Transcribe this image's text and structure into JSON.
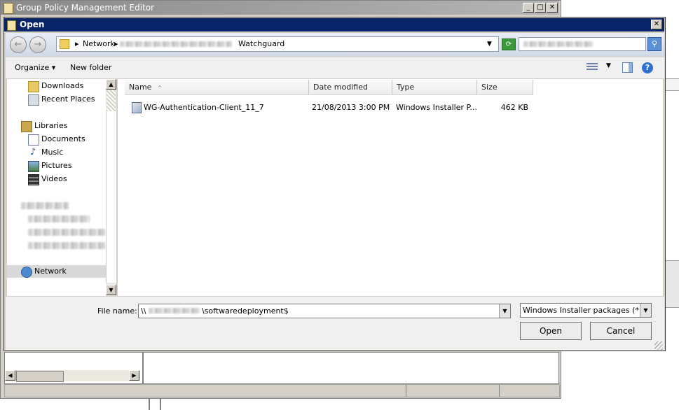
{
  "background_window": {
    "title": "Group Policy Management Editor",
    "controls": {
      "minimize": "_",
      "maximize": "□",
      "close": "✕"
    }
  },
  "dialog": {
    "title": "Open",
    "close_label": "✕",
    "address_crumbs": [
      "Network",
      "Watchguard"
    ],
    "toolbar": {
      "organize": "Organize ▾",
      "new_folder": "New folder"
    },
    "nav_tree": [
      {
        "label": "Downloads",
        "icon": "downloads-folder-icon"
      },
      {
        "label": "Recent Places",
        "icon": "recent-places-icon"
      },
      {
        "label": "Libraries",
        "icon": "libraries-icon"
      },
      {
        "label": "Documents",
        "icon": "documents-icon"
      },
      {
        "label": "Music",
        "icon": "music-icon"
      },
      {
        "label": "Pictures",
        "icon": "pictures-icon"
      },
      {
        "label": "Videos",
        "icon": "videos-icon"
      },
      {
        "label": "Network",
        "icon": "network-icon"
      }
    ],
    "columns": [
      "Name",
      "Date modified",
      "Type",
      "Size"
    ],
    "files": [
      {
        "name": "WG-Authentication-Client_11_7",
        "date": "21/08/2013 3:00 PM",
        "type": "Windows Installer P...",
        "size": "462 KB",
        "icon": "msi-package-icon"
      }
    ],
    "filename_label": "File name:",
    "filename_prefix": "\\\\",
    "filename_suffix": "\\softwaredeployment$",
    "filetype_value": "Windows Installer packages (*.r",
    "open_label": "Open",
    "cancel_label": "Cancel"
  }
}
